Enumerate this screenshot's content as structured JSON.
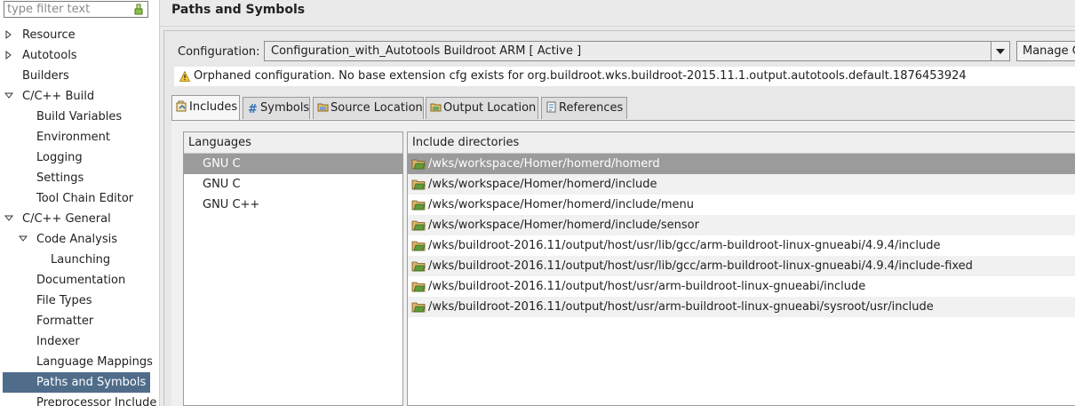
{
  "filter": {
    "placeholder": "type filter text"
  },
  "tree": [
    {
      "label": "Resource",
      "twisty": "collapsed"
    },
    {
      "label": "Autotools",
      "twisty": "collapsed"
    },
    {
      "label": "Builders",
      "twisty": "none"
    },
    {
      "label": "C/C++ Build",
      "twisty": "expanded"
    },
    {
      "label": "Build Variables",
      "twisty": "none"
    },
    {
      "label": "Environment",
      "twisty": "none"
    },
    {
      "label": "Logging",
      "twisty": "none"
    },
    {
      "label": "Settings",
      "twisty": "none"
    },
    {
      "label": "Tool Chain Editor",
      "twisty": "none"
    },
    {
      "label": "C/C++ General",
      "twisty": "expanded"
    },
    {
      "label": "Code Analysis",
      "twisty": "expanded"
    },
    {
      "label": "Launching",
      "twisty": "none"
    },
    {
      "label": "Documentation",
      "twisty": "none"
    },
    {
      "label": "File Types",
      "twisty": "none"
    },
    {
      "label": "Formatter",
      "twisty": "none"
    },
    {
      "label": "Indexer",
      "twisty": "none"
    },
    {
      "label": "Language Mappings",
      "twisty": "none"
    },
    {
      "label": "Paths and Symbols",
      "twisty": "none",
      "selected": true
    },
    {
      "label": "Preprocessor Include",
      "twisty": "none"
    }
  ],
  "page": {
    "title": "Paths and Symbols"
  },
  "configuration": {
    "label": "Configuration:",
    "value": "Configuration_with_Autotools Buildroot ARM  [ Active ]",
    "manage_label": "Manage C"
  },
  "warning": {
    "icon": "warning-icon",
    "text": "Orphaned configuration. No base extension cfg exists for org.buildroot.wks.buildroot-2015.11.1.output.autotools.default.1876453924"
  },
  "tabs": [
    {
      "label": "Includes",
      "icon": "includes-icon",
      "active": true
    },
    {
      "label": "Symbols",
      "icon": "hash-icon"
    },
    {
      "label": "Source Location",
      "icon": "source-folder-icon"
    },
    {
      "label": "Output Location",
      "icon": "output-folder-icon"
    },
    {
      "label": "References",
      "icon": "references-icon"
    }
  ],
  "languages": {
    "header": "Languages",
    "items": [
      "GNU C",
      "GNU C",
      "GNU C++"
    ],
    "selected_index": 0
  },
  "includes": {
    "header": "Include directories",
    "items": [
      "/wks/workspace/Homer/homerd/homerd",
      "/wks/workspace/Homer/homerd/include",
      "/wks/workspace/Homer/homerd/include/menu",
      "/wks/workspace/Homer/homerd/include/sensor",
      "/wks/buildroot-2016.11/output/host/usr/lib/gcc/arm-buildroot-linux-gnueabi/4.9.4/include",
      "/wks/buildroot-2016.11/output/host/usr/lib/gcc/arm-buildroot-linux-gnueabi/4.9.4/include-fixed",
      "/wks/buildroot-2016.11/output/host/usr/arm-buildroot-linux-gnueabi/include",
      "/wks/buildroot-2016.11/output/host/usr/arm-buildroot-linux-gnueabi/sysroot/usr/include"
    ],
    "selected_index": 0
  },
  "colors": {
    "tree_selection": "#4f6c8a",
    "table_selection": "#9b9b9b",
    "folder_green": "#5f9a3b",
    "folder_tan": "#d9b46a"
  }
}
